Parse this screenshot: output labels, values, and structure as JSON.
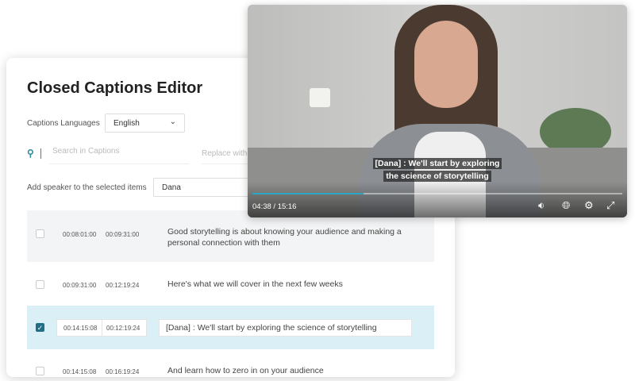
{
  "editor": {
    "title": "Closed Captions Editor",
    "languages_label": "Captions Languages",
    "language": "English",
    "search_placeholder": "Search in Captions",
    "replace_placeholder": "Replace with",
    "speaker_label": "Add speaker to the selected items",
    "speaker_value": "Dana"
  },
  "rows": [
    {
      "start": "00:08:01:00",
      "end": "00:09:31:00",
      "text": "Good storytelling is about knowing your audience and making a personal connection with them",
      "checked": false
    },
    {
      "start": "00:09:31:00",
      "end": "00:12:19:24",
      "text": "Here's what we will cover in the next few weeks",
      "checked": false
    },
    {
      "start": "00:14:15:08",
      "end": "00:12:19:24",
      "text": "[Dana] : We'll start by exploring the science of storytelling",
      "checked": true
    },
    {
      "start": "00:14:15:08",
      "end": "00:16:19:24",
      "text": "And learn how to zero in on your audience",
      "checked": false
    }
  ],
  "video": {
    "caption_line1": "[Dana] : We'll start by exploring",
    "caption_line2": "the science of storytelling",
    "time": "04:38 / 15:16",
    "progress": 0.3,
    "accent": "#2aa6c4"
  }
}
